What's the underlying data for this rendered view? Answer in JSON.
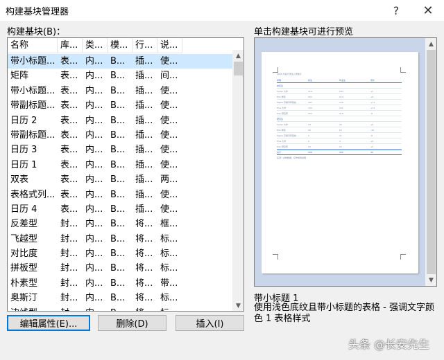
{
  "window": {
    "title": "构建基块管理器",
    "help_glyph": "?",
    "close_glyph": "✕"
  },
  "list_label": "构建基块(B)：",
  "preview_label": "单击构建基块可进行预览",
  "columns": [
    "名称",
    "库...",
    "类...",
    "模...",
    "行...",
    "说..."
  ],
  "rows": [
    [
      "带小标题...",
      "表...",
      "内...",
      "B...",
      "插...",
      "使..."
    ],
    [
      "矩阵",
      "表...",
      "内...",
      "B...",
      "插...",
      "间..."
    ],
    [
      "带小标题...",
      "表...",
      "内...",
      "B...",
      "插...",
      "使..."
    ],
    [
      "带副标题...",
      "表...",
      "内...",
      "B...",
      "插...",
      "使..."
    ],
    [
      "日历 2",
      "表...",
      "内...",
      "B...",
      "插...",
      "使..."
    ],
    [
      "带副标题...",
      "表...",
      "内...",
      "B...",
      "插...",
      "使..."
    ],
    [
      "日历 3",
      "表...",
      "内...",
      "B...",
      "插...",
      "使..."
    ],
    [
      "日历 1",
      "表...",
      "内...",
      "B...",
      "插...",
      "使..."
    ],
    [
      "双表",
      "表...",
      "内...",
      "B...",
      "插...",
      "两..."
    ],
    [
      "表格式列...",
      "表...",
      "内...",
      "B...",
      "插...",
      "使..."
    ],
    [
      "日历 4",
      "表...",
      "内...",
      "B...",
      "插...",
      "使..."
    ],
    [
      "反差型",
      "封...",
      "内...",
      "B...",
      "将...",
      "框..."
    ],
    [
      "飞越型",
      "封...",
      "内...",
      "B...",
      "将...",
      "标..."
    ],
    [
      "对比度",
      "封...",
      "内...",
      "B...",
      "将...",
      "标..."
    ],
    [
      "拼板型",
      "封...",
      "内...",
      "B...",
      "将...",
      "标..."
    ],
    [
      "朴素型",
      "封...",
      "内...",
      "B...",
      "将...",
      "带..."
    ],
    [
      "奥斯汀",
      "封...",
      "内...",
      "B...",
      "将...",
      "标..."
    ],
    [
      "边线型",
      "封...",
      "内...",
      "B...",
      "将...",
      "标..."
    ]
  ],
  "selected_row": 0,
  "buttons": {
    "edit": "编辑属性(E)...",
    "delete": "删除(D)",
    "insert": "插入(I)"
  },
  "selected_name": "带小标题 1",
  "description": "使用浅色底纹且带小标题的表格 - 强调文字颜色 1 表格样式",
  "watermark": "头条 @长安先生",
  "preview_table": {
    "title": "2005 年度大学生入学统计",
    "header": [
      "学院",
      "新生",
      "毕业生",
      "增长"
    ],
    "sections": [
      {
        "heading": "本科生",
        "rows": [
          [
            "Cedar 大学",
            "110",
            "103",
            "+7"
          ],
          [
            "Elm 学院",
            "223",
            "214",
            "+9"
          ],
          [
            "Maple 高等专科院校",
            "197",
            "120",
            "+77"
          ],
          [
            "Pine 大学",
            "134",
            "121",
            "+13"
          ],
          [
            "Oak 研究所",
            "202",
            "210",
            "-8"
          ]
        ]
      },
      {
        "heading": "研究生",
        "rows": [
          [
            "Cedar 大学",
            "24",
            "20",
            "+4"
          ],
          [
            "Elm 学院",
            "43",
            "53",
            "-10"
          ],
          [
            "Maple 高等专科院校",
            "3",
            "11",
            "-8"
          ],
          [
            "Pine 大学",
            "9",
            "4",
            "+5"
          ],
          [
            "Oak 研究所",
            "53",
            "52",
            "+1"
          ]
        ]
      }
    ],
    "total": [
      "总计",
      "998",
      "908",
      "90"
    ],
    "footnote": "来源：虚构数据，仅作举例说明"
  },
  "colors": {
    "accent": "#0078d7",
    "selection": "#cde8ff",
    "preview_bg": "#c9d5e8",
    "table_accent": "#4472c4"
  }
}
